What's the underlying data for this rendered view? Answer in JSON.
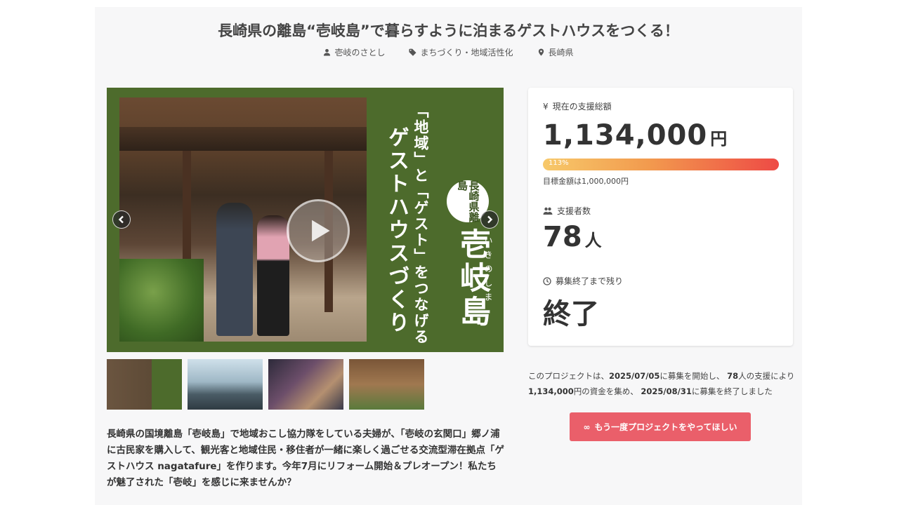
{
  "project": {
    "title": "長崎県の離島“壱岐島”で暮らすように泊まるゲストハウスをつくる！",
    "owner": "壱岐のさとし",
    "category": "まちづくり・地域活性化",
    "location": "長崎県"
  },
  "hero": {
    "heading_small": "「地域」と「ゲスト」をつなげる",
    "heading_large": "ゲストハウスづくり",
    "badge": "長崎県離島",
    "island": "壱岐島",
    "island_reading": "いきのしま"
  },
  "description": "長崎県の国境離島「壱岐島」で地域おこし協力隊をしている夫婦が、「壱岐の玄関口」郷ノ浦に古民家を購入して、観光客と地域住民・移住者が一緒に楽しく過ごせる交流型滞在拠点「ゲストハウス nagatafure」を作ります。今年7月にリフォーム開始＆プレオープン！私たちが魅了された「壱岐」を感じに来ませんか？",
  "stats": {
    "currency_symbol": "¥",
    "total_label": "現在の支援総額",
    "total_amount": "1,134,000",
    "total_unit": "円",
    "progress_label": "113%",
    "progress": 1.13,
    "goal_text": "目標金額は1,000,000円",
    "backers_label": "支援者数",
    "backers_count": "78",
    "backers_unit": "人",
    "remaining_label": "募集終了まで残り",
    "remaining_value": "終了"
  },
  "summary": {
    "p1": "このプロジェクトは、",
    "start_date": "2025/07/05",
    "p2": "に募集を開始し、",
    "backers": "78",
    "p3": "人の支援により",
    "amount": "1,134,000",
    "p4": "円の資金を集め、",
    "end_date": "2025/08/31",
    "p5": "に募集を終了しました"
  },
  "cta": {
    "icon": "infinity-icon",
    "label": "もう一度プロジェクトをやってほしい"
  },
  "colors": {
    "hero_green": "#4d6b2c",
    "cta": "#ea5f6a",
    "bar_start": "#f7c96a",
    "bar_end": "#ee4a45"
  }
}
